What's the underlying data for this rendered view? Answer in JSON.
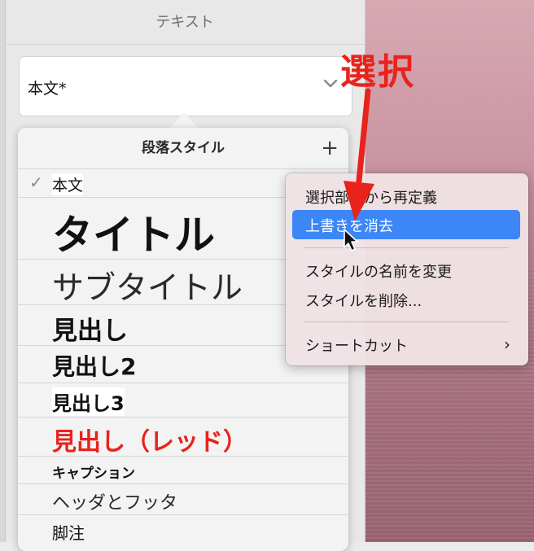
{
  "inspector": {
    "tab_title": "テキスト",
    "current_style": "本文*"
  },
  "paragraph_styles": {
    "header": "段落スタイル",
    "add_icon": "plus-icon",
    "items": [
      {
        "label": "本文",
        "checked": true
      },
      {
        "label": "タイトル"
      },
      {
        "label": "サブタイトル"
      },
      {
        "label": "見出し"
      },
      {
        "label": "見出し2"
      },
      {
        "label": "見出し3"
      },
      {
        "label": "見出し（レッド）",
        "color": "#e8231c"
      },
      {
        "label": "キャプション"
      },
      {
        "label": "ヘッダとフッタ"
      },
      {
        "label": "脚注"
      }
    ]
  },
  "context_menu": {
    "items": [
      {
        "label": "選択部分から再定義"
      },
      {
        "label": "上書きを消去",
        "highlighted": true
      },
      {
        "label": "スタイルの名前を変更"
      },
      {
        "label": "スタイルを削除..."
      },
      {
        "label": "ショートカット",
        "submenu": true
      }
    ],
    "highlight_color": "#3c86f6"
  },
  "annotation": {
    "label": "選択",
    "color": "#e8231c"
  }
}
